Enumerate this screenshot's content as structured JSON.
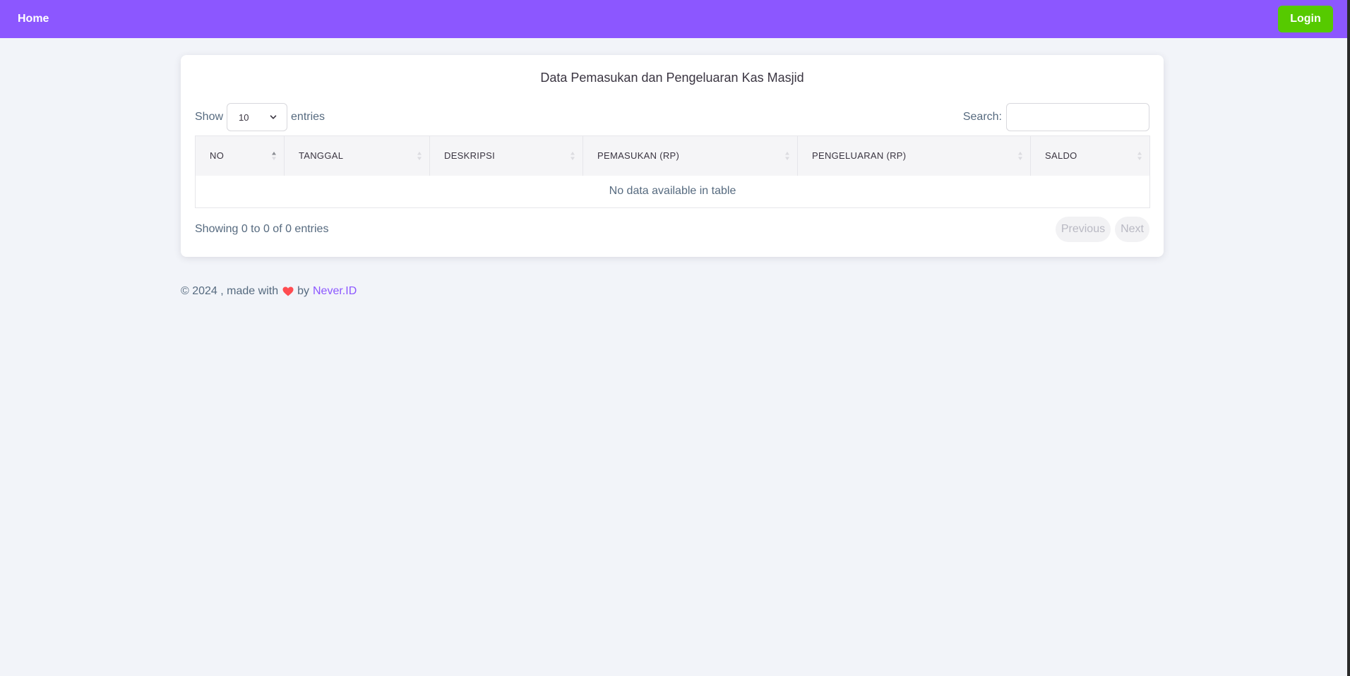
{
  "navbar": {
    "home_label": "Home",
    "login_label": "Login"
  },
  "card": {
    "title": "Data Pemasukan dan Pengeluaran Kas Masjid"
  },
  "controls": {
    "show_label": "Show",
    "entries_value": "10",
    "entries_label": "entries",
    "search_label": "Search:",
    "search_value": ""
  },
  "table": {
    "columns": [
      "NO",
      "TANGGAL",
      "DESKRIPSI",
      "PEMASUKAN (RP)",
      "PENGELUARAN (RP)",
      "SALDO"
    ],
    "empty_message": "No data available in table"
  },
  "pagination": {
    "info": "Showing 0 to 0 of 0 entries",
    "previous_label": "Previous",
    "next_label": "Next"
  },
  "footer": {
    "prefix": "© 2024 , made with",
    "by": "by",
    "link_label": "Never.ID"
  },
  "colors": {
    "navbar": "#8c57ff",
    "login": "#56ca00",
    "heart": "#ff4c51",
    "link": "#8c57ff",
    "background": "#f2f4f9"
  },
  "icons": {
    "sort": "sort-arrows-icon",
    "select": "chevron-down-icon",
    "heart": "heart-icon"
  }
}
